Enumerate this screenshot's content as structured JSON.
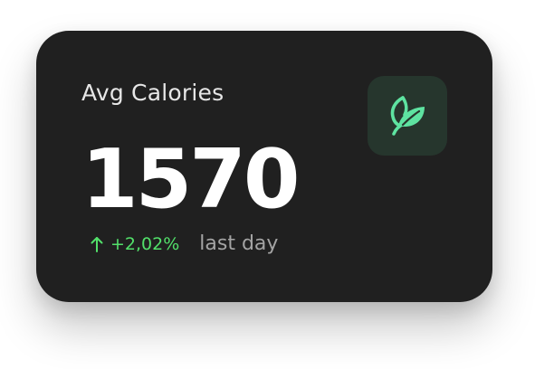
{
  "card": {
    "title": "Avg Calories",
    "value": "1570",
    "change": {
      "direction": "up",
      "percent": "+2,02%",
      "period": "last day"
    },
    "icon": "leaf-icon"
  },
  "colors": {
    "card_background": "#202020",
    "positive": "#52e06a",
    "icon_tile": "#26362d",
    "icon": "#5ee3a1",
    "muted_text": "#a4a4a4"
  }
}
